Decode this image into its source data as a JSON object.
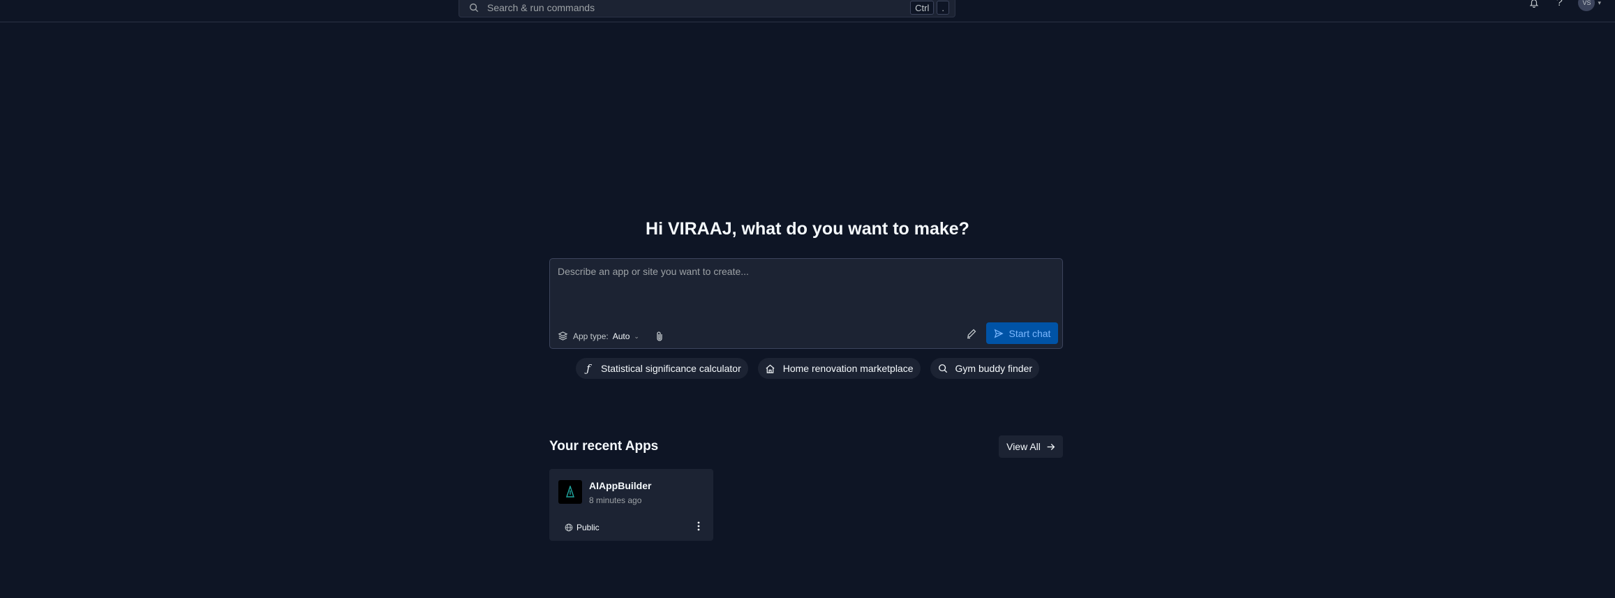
{
  "topbar": {
    "search_placeholder": "Search & run commands",
    "shortcut_key1": "Ctrl",
    "shortcut_key2": ".",
    "notifications_icon": "bell-icon",
    "help_icon": "?",
    "avatar_initials": "VS"
  },
  "main": {
    "headline": "Hi VIRAAJ, what do you want to make?",
    "prompt_placeholder": "Describe an app or site you want to create...",
    "app_type_label": "App type:",
    "app_type_value": "Auto",
    "start_chat_label": "Start chat",
    "suggestions": [
      {
        "label": "Statistical significance calculator",
        "icon": "function-icon"
      },
      {
        "label": "Home renovation marketplace",
        "icon": "home-icon"
      },
      {
        "label": "Gym buddy finder",
        "icon": "search-icon"
      }
    ]
  },
  "recent": {
    "title": "Your recent Apps",
    "view_all_label": "View All",
    "apps": [
      {
        "name": "AIAppBuilder",
        "time": "8 minutes ago",
        "visibility": "Public"
      }
    ]
  },
  "colors": {
    "background": "#0e1525",
    "surface": "#1c2333",
    "accent": "#0053a6",
    "accent_text": "#7cb8ff"
  }
}
